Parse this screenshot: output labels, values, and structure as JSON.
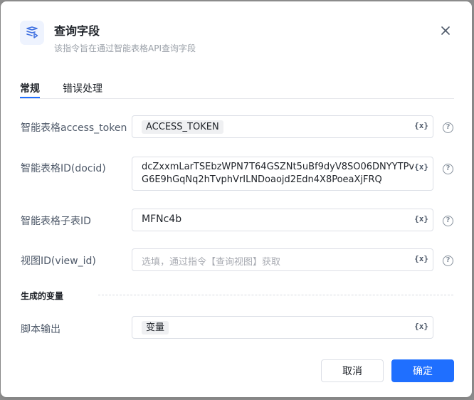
{
  "dialog": {
    "title": "查询字段",
    "subtitle": "该指令旨在通过智能表格API查询字段",
    "icon": "table-query-icon",
    "close_icon": "close-icon"
  },
  "tabs": [
    {
      "label": "常规",
      "active": true
    },
    {
      "label": "错误处理",
      "active": false
    }
  ],
  "fields": {
    "access_token": {
      "label": "智能表格access_token",
      "value": "ACCESS_TOKEN"
    },
    "docid": {
      "label": "智能表格ID(docid)",
      "value": "dcZxxmLarTSEbzWPN7T64GSZNt5uBf9dyV8SO06DNYYTPvG6E9hGqNq2hTvphVrILNDoaojd2Edn4X8PoeaXjFRQ"
    },
    "sheet_id": {
      "label": "智能表格子表ID",
      "value": "MFNc4b"
    },
    "view_id": {
      "label": "视图ID(view_id)",
      "placeholder": "选填，通过指令【查询视图】获取"
    }
  },
  "output_section": {
    "title": "生成的变量",
    "script_output": {
      "label": "脚本输出",
      "value": "变量"
    }
  },
  "var_button_label": "{x}",
  "help_label": "?",
  "buttons": {
    "cancel": "取消",
    "confirm": "确定"
  },
  "colors": {
    "accent": "#1f6fff",
    "icon_bg": "#eef3fe"
  }
}
